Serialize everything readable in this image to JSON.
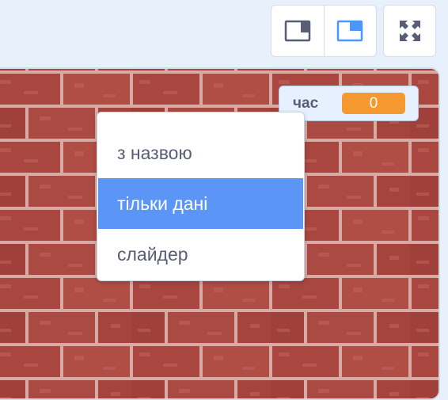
{
  "toolbar": {
    "small_stage_icon": "small-stage-icon",
    "normal_stage_icon": "normal-stage-icon",
    "fullscreen_icon": "fullscreen-icon",
    "active_color": "#4c97ff"
  },
  "monitor": {
    "label": "час",
    "value": "0",
    "value_color": "#f4982f"
  },
  "context_menu": {
    "items": [
      {
        "label": "з назвою"
      },
      {
        "label": "тільки дані"
      },
      {
        "label": "слайдер"
      }
    ],
    "selected_index": 1,
    "highlight_color": "#5b96f7"
  },
  "stage": {
    "backdrop": "red brick wall"
  }
}
